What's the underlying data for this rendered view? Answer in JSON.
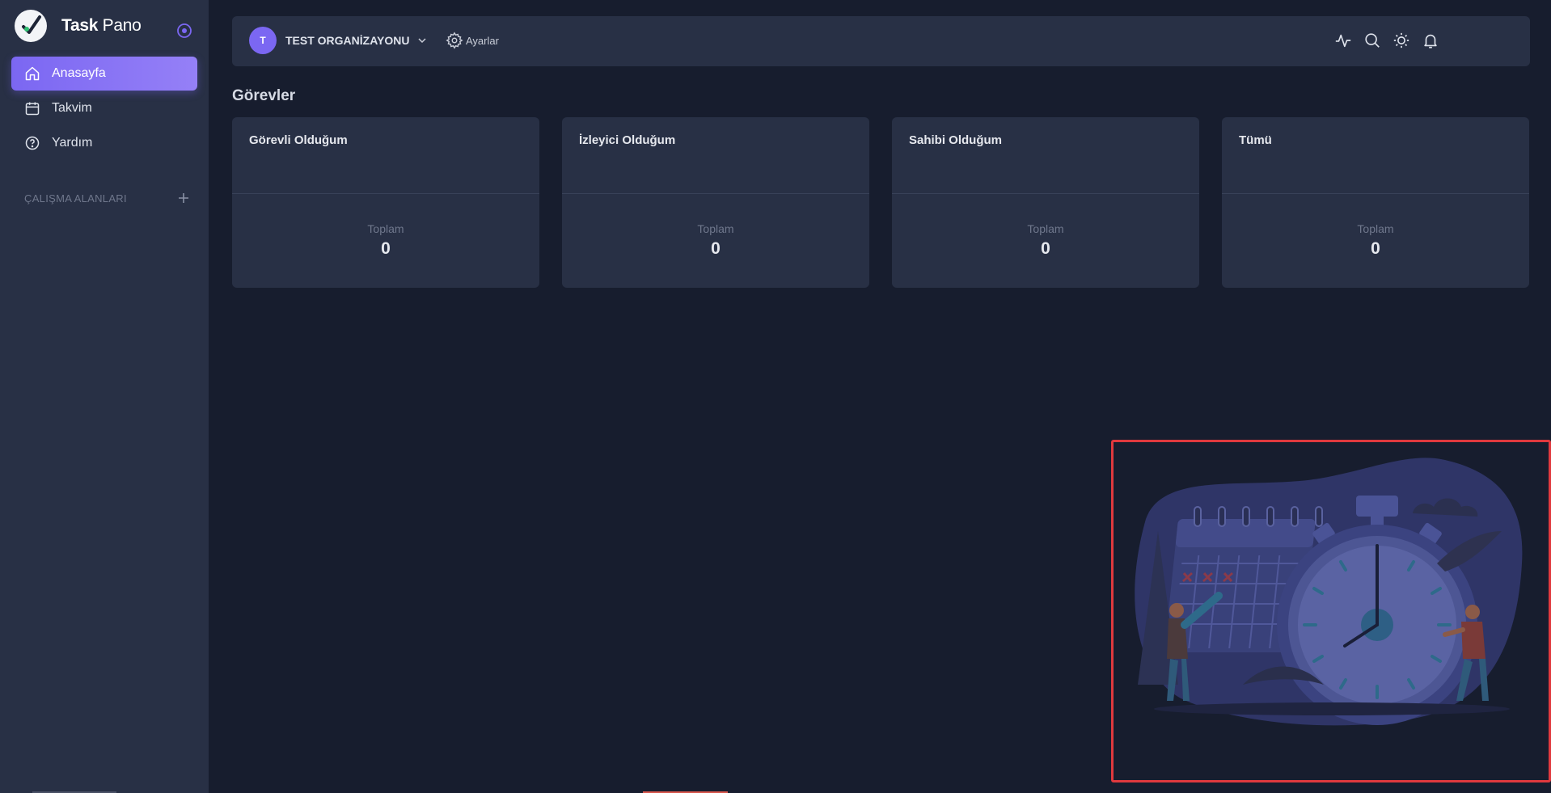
{
  "brand": {
    "name_bold": "Task",
    "name_light": "Pano"
  },
  "sidebar": {
    "items": [
      {
        "label": "Anasayfa",
        "icon": "home-icon",
        "active": true
      },
      {
        "label": "Takvim",
        "icon": "calendar-icon",
        "active": false
      },
      {
        "label": "Yardım",
        "icon": "help-icon",
        "active": false
      }
    ],
    "section_title": "ÇALIŞMA ALANLARI"
  },
  "header": {
    "org_initial": "T",
    "org_name": "TEST ORGANİZAYONU",
    "settings_label": "Ayarlar",
    "icons": [
      "activity-icon",
      "search-icon",
      "sun-icon",
      "bell-icon"
    ]
  },
  "main": {
    "title": "Görevler",
    "cards": [
      {
        "title": "Görevli Olduğum",
        "total_label": "Toplam",
        "total": "0"
      },
      {
        "title": "İzleyici Olduğum",
        "total_label": "Toplam",
        "total": "0"
      },
      {
        "title": "Sahibi Olduğum",
        "total_label": "Toplam",
        "total": "0"
      },
      {
        "title": "Tümü",
        "total_label": "Toplam",
        "total": "0"
      }
    ]
  },
  "colors": {
    "background": "#171d2e",
    "panel": "#283045",
    "accent": "#7b67f2",
    "highlight_frame": "#e0393e"
  }
}
